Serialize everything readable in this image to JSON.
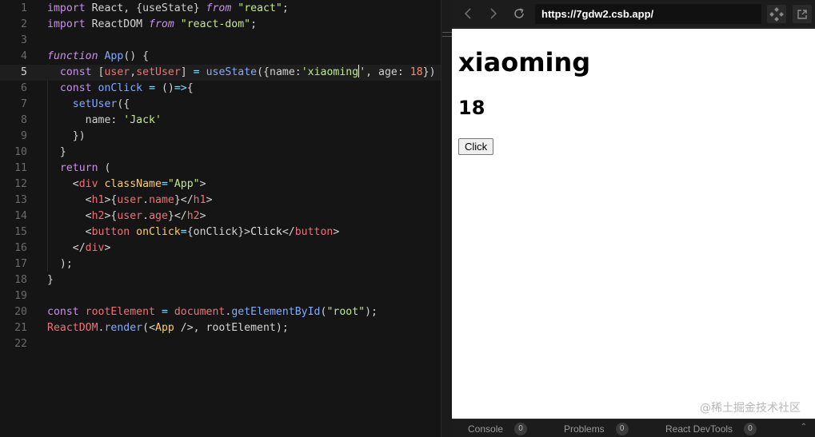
{
  "editor": {
    "active_line": 5,
    "lines": [
      {
        "n": "1",
        "tokens": [
          [
            "kw",
            "import"
          ],
          [
            "pun",
            " React, {"
          ],
          [
            "prop",
            "useState"
          ],
          [
            "pun",
            "} "
          ],
          [
            "kw2",
            "from"
          ],
          [
            "pun",
            " "
          ],
          [
            "str",
            "\"react\""
          ],
          [
            "pun",
            ";"
          ]
        ]
      },
      {
        "n": "2",
        "tokens": [
          [
            "kw",
            "import"
          ],
          [
            "pun",
            " ReactDOM "
          ],
          [
            "kw2",
            "from"
          ],
          [
            "pun",
            " "
          ],
          [
            "str",
            "\"react-dom\""
          ],
          [
            "pun",
            ";"
          ]
        ]
      },
      {
        "n": "3",
        "tokens": []
      },
      {
        "n": "4",
        "tokens": [
          [
            "kw2",
            "function"
          ],
          [
            "pun",
            " "
          ],
          [
            "fn",
            "App"
          ],
          [
            "pun",
            "() {"
          ]
        ]
      },
      {
        "n": "5",
        "tokens": [
          [
            "pun",
            "  "
          ],
          [
            "kw",
            "const"
          ],
          [
            "pun",
            " ["
          ],
          [
            "var",
            "user"
          ],
          [
            "pun",
            ","
          ],
          [
            "var",
            "setUser"
          ],
          [
            "pun",
            "] "
          ],
          [
            "op",
            "="
          ],
          [
            "pun",
            " "
          ],
          [
            "fn",
            "useState"
          ],
          [
            "pun",
            "({"
          ],
          [
            "prop",
            "name"
          ],
          [
            "pun",
            ":"
          ],
          [
            "str",
            "'xiaoming"
          ],
          [
            "caret",
            ""
          ],
          [
            "str",
            "'"
          ],
          [
            "pun",
            ", "
          ],
          [
            "prop",
            "age"
          ],
          [
            "pun",
            ": "
          ],
          [
            "num",
            "18"
          ],
          [
            "pun",
            "})"
          ]
        ]
      },
      {
        "n": "6",
        "tokens": [
          [
            "pun",
            "  "
          ],
          [
            "kw",
            "const"
          ],
          [
            "pun",
            " "
          ],
          [
            "fn",
            "onClick"
          ],
          [
            "pun",
            " "
          ],
          [
            "op",
            "="
          ],
          [
            "pun",
            " ()"
          ],
          [
            "op",
            "=>"
          ],
          [
            "pun",
            "{"
          ]
        ]
      },
      {
        "n": "7",
        "tokens": [
          [
            "pun",
            "    "
          ],
          [
            "fn",
            "setUser"
          ],
          [
            "pun",
            "({"
          ]
        ]
      },
      {
        "n": "8",
        "tokens": [
          [
            "pun",
            "      "
          ],
          [
            "prop",
            "name"
          ],
          [
            "pun",
            ": "
          ],
          [
            "str",
            "'Jack'"
          ]
        ]
      },
      {
        "n": "9",
        "tokens": [
          [
            "pun",
            "    })"
          ]
        ]
      },
      {
        "n": "10",
        "tokens": [
          [
            "pun",
            "  }"
          ]
        ]
      },
      {
        "n": "11",
        "tokens": [
          [
            "pun",
            "  "
          ],
          [
            "kw",
            "return"
          ],
          [
            "pun",
            " ("
          ]
        ]
      },
      {
        "n": "12",
        "tokens": [
          [
            "pun",
            "    <"
          ],
          [
            "tag",
            "div"
          ],
          [
            "pun",
            " "
          ],
          [
            "attr",
            "className"
          ],
          [
            "op",
            "="
          ],
          [
            "str",
            "\"App\""
          ],
          [
            "pun",
            ">"
          ]
        ]
      },
      {
        "n": "13",
        "tokens": [
          [
            "pun",
            "      <"
          ],
          [
            "tag",
            "h1"
          ],
          [
            "pun",
            ">{"
          ],
          [
            "var",
            "user"
          ],
          [
            "pun",
            "."
          ],
          [
            "var",
            "name"
          ],
          [
            "pun",
            "}</"
          ],
          [
            "tag",
            "h1"
          ],
          [
            "pun",
            ">"
          ]
        ]
      },
      {
        "n": "14",
        "tokens": [
          [
            "pun",
            "      <"
          ],
          [
            "tag",
            "h2"
          ],
          [
            "pun",
            ">{"
          ],
          [
            "var",
            "user"
          ],
          [
            "pun",
            "."
          ],
          [
            "var",
            "age"
          ],
          [
            "pun",
            "}</"
          ],
          [
            "tag",
            "h2"
          ],
          [
            "pun",
            ">"
          ]
        ]
      },
      {
        "n": "15",
        "tokens": [
          [
            "pun",
            "      <"
          ],
          [
            "tag",
            "button"
          ],
          [
            "pun",
            " "
          ],
          [
            "attr",
            "onClick"
          ],
          [
            "op",
            "="
          ],
          [
            "pun",
            "{onClick}>"
          ],
          [
            "txt",
            "Click"
          ],
          [
            "pun",
            "</"
          ],
          [
            "tag",
            "button"
          ],
          [
            "pun",
            ">"
          ]
        ]
      },
      {
        "n": "16",
        "tokens": [
          [
            "pun",
            "    </"
          ],
          [
            "tag",
            "div"
          ],
          [
            "pun",
            ">"
          ]
        ]
      },
      {
        "n": "17",
        "tokens": [
          [
            "pun",
            "  );"
          ]
        ]
      },
      {
        "n": "18",
        "tokens": [
          [
            "pun",
            "}"
          ]
        ]
      },
      {
        "n": "19",
        "tokens": []
      },
      {
        "n": "20",
        "tokens": [
          [
            "kw",
            "const"
          ],
          [
            "pun",
            " "
          ],
          [
            "var",
            "rootElement"
          ],
          [
            "pun",
            " "
          ],
          [
            "op",
            "="
          ],
          [
            "pun",
            " "
          ],
          [
            "var",
            "document"
          ],
          [
            "pun",
            "."
          ],
          [
            "fn",
            "getElementById"
          ],
          [
            "pun",
            "("
          ],
          [
            "str",
            "\"root\""
          ],
          [
            "pun",
            ");"
          ]
        ]
      },
      {
        "n": "21",
        "tokens": [
          [
            "var",
            "ReactDOM"
          ],
          [
            "pun",
            "."
          ],
          [
            "fn",
            "render"
          ],
          [
            "pun",
            "(<"
          ],
          [
            "cmp",
            "App"
          ],
          [
            "pun",
            " />, rootElement);"
          ]
        ]
      },
      {
        "n": "22",
        "tokens": []
      }
    ]
  },
  "browser": {
    "back_icon": "chevron-left-icon",
    "forward_icon": "chevron-right-icon",
    "refresh_icon": "refresh-icon",
    "url": "https://7gdw2.csb.app/",
    "devtools_icon": "move-icon",
    "open_new_icon": "external-link-icon"
  },
  "preview": {
    "heading": "xiaoming",
    "subheading": "18",
    "button_label": "Click",
    "watermark": "@稀土掘金技术社区"
  },
  "panel": {
    "tabs": [
      {
        "label": "Console",
        "count": "0"
      },
      {
        "label": "Problems",
        "count": "0"
      },
      {
        "label": "React DevTools",
        "count": "0"
      }
    ]
  },
  "colors": {
    "editor_bg": "#151515",
    "keyword": "#c792ea",
    "function": "#82aaff",
    "string": "#c3e88d",
    "variable": "#f07178",
    "number": "#f78c6c"
  }
}
